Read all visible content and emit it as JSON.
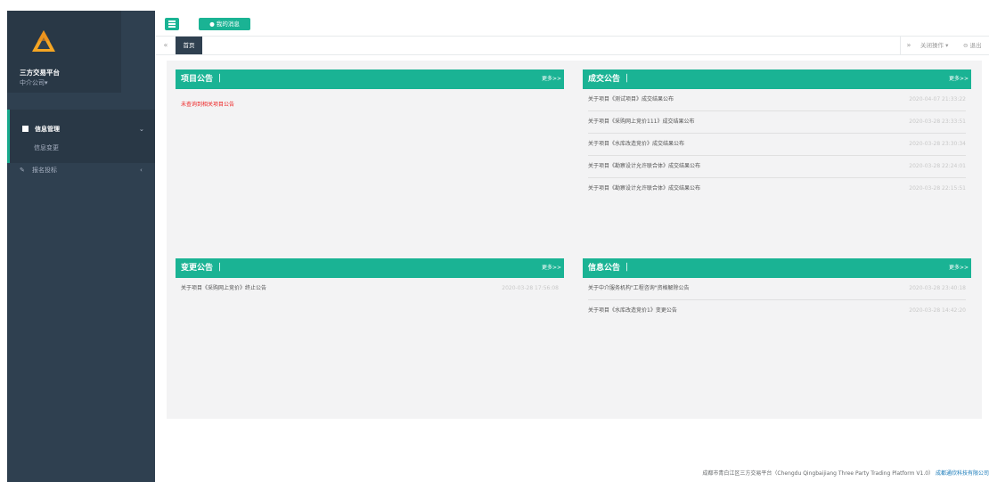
{
  "sidebar": {
    "brand_name": "三方交易平台",
    "brand_sub": "中介公司▾",
    "menu": [
      {
        "label": "信息管理",
        "arrow": "⌄",
        "submenu": [
          "信息变更"
        ]
      },
      {
        "label": "报名投标",
        "icon": "✎",
        "arrow": "‹"
      }
    ]
  },
  "topbar": {
    "message_button": "● 我的消息"
  },
  "tabs": {
    "left_arrow": "«",
    "active_tab": "首页",
    "right_arrow": "»",
    "close_ops": "关闭操作 ▾",
    "logout": "⊖ 退出"
  },
  "panels": {
    "project": {
      "title": "项目公告 ｜",
      "more": "更多>>",
      "empty": "未查询到相关项目公告"
    },
    "deal": {
      "title": "成交公告 ｜",
      "more": "更多>>",
      "rows": [
        {
          "text": "关于项目《测试项目》成交结果公布",
          "date": "2020-04-07 21:33:22"
        },
        {
          "text": "关于项目《采购网上竞价111》成交结果公布",
          "date": "2020-03-28 23:33:51"
        },
        {
          "text": "关于项目《水库改造竞价》成交结果公布",
          "date": "2020-03-28 23:30:34"
        },
        {
          "text": "关于项目《勘察设计允许联合体》成交结果公布",
          "date": "2020-03-28 22:24:01"
        },
        {
          "text": "关于项目《勘察设计允许联合体》成交结果公布",
          "date": "2020-03-28 22:15:51"
        }
      ]
    },
    "change": {
      "title": "变更公告 ｜",
      "more": "更多>>",
      "rows": [
        {
          "text": "关于项目《采购网上竞价》终止公告",
          "date": "2020-03-28 17:56:08"
        }
      ]
    },
    "info": {
      "title": "信息公告 ｜",
      "more": "更多>>",
      "rows": [
        {
          "text": "关于中介服务机构\"工程咨询\"资格解除公告",
          "date": "2020-03-28 23:40:18"
        },
        {
          "text": "关于项目《水库改造竞价1》变更公告",
          "date": "2020-03-28 14:42:20"
        }
      ]
    }
  },
  "footer": {
    "text": "成都市青白江区三方交易平台（Chengdu Qingbaijiang Three Party Trading Platform V1.0）",
    "company": "成都通欣科技有限公司"
  },
  "colors": {
    "accent": "#1ab394",
    "sidebar": "#2f4050",
    "sidebar_dark": "#293846"
  }
}
